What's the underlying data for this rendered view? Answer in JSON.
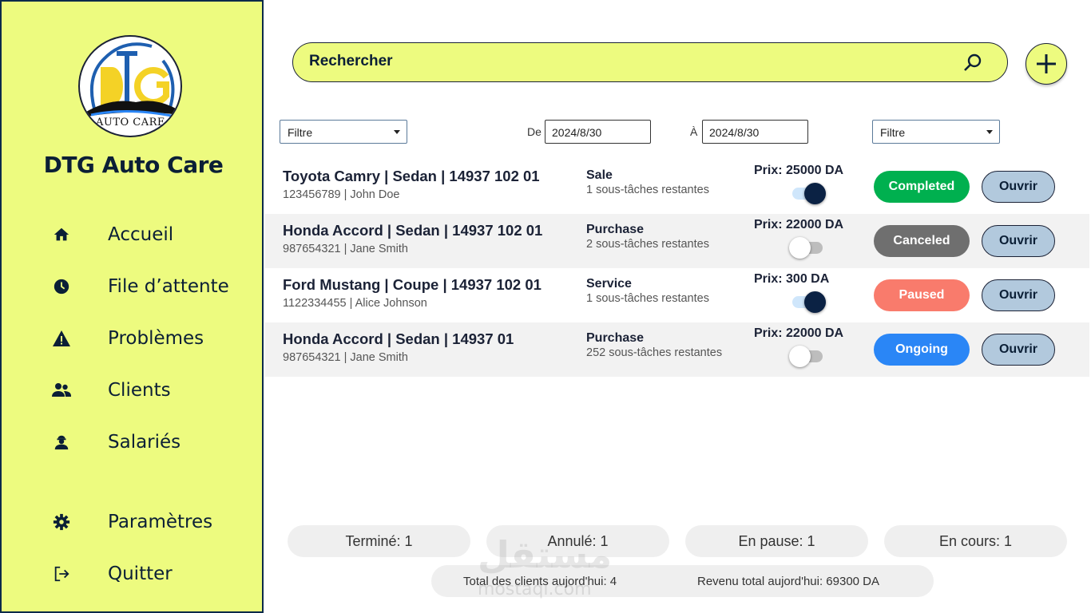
{
  "app": {
    "brand_name": "DTG Auto Care",
    "logo_text": "AUTO CARE",
    "logo_letters": "DTG"
  },
  "sidebar": {
    "items": [
      {
        "label": "Accueil",
        "icon": "home-icon"
      },
      {
        "label": "File d’attente",
        "icon": "clock-icon"
      },
      {
        "label": "Problèmes",
        "icon": "warning-icon"
      },
      {
        "label": "Clients",
        "icon": "people-icon"
      },
      {
        "label": "Salariés",
        "icon": "worker-icon"
      },
      {
        "label": "Paramètres",
        "icon": "gear-icon"
      },
      {
        "label": "Quitter",
        "icon": "logout-icon"
      }
    ]
  },
  "search": {
    "placeholder": "Rechercher",
    "icon": "search-icon"
  },
  "add_button": {
    "icon": "plus-icon"
  },
  "filters": {
    "left_select": "Filtre",
    "right_select": "Filtre",
    "from_label": "De",
    "from_value": "2024/8/30",
    "to_label": "À",
    "to_value": "2024/8/30"
  },
  "orders": [
    {
      "title": "Toyota Camry | Sedan | 14937 102 01",
      "sub": "123456789 | John Doe",
      "type": "Sale",
      "tasks": "1 sous-tâches restantes",
      "price": "Prix: 25000 DA",
      "toggle_on": true,
      "status": "Completed",
      "status_color": "#00b04f",
      "open_label": "Ouvrir"
    },
    {
      "title": "Honda Accord | Sedan | 14937 102 01",
      "sub": "987654321 | Jane Smith",
      "type": "Purchase",
      "tasks": "2 sous-tâches restantes",
      "price": "Prix: 22000 DA",
      "toggle_on": false,
      "status": "Canceled",
      "status_color": "#6f6f6f",
      "open_label": "Ouvrir"
    },
    {
      "title": "Ford Mustang | Coupe | 14937 102 01",
      "sub": "1122334455 | Alice Johnson",
      "type": "Service",
      "tasks": "1 sous-tâches restantes",
      "price": "Prix: 300 DA",
      "toggle_on": true,
      "status": "Paused",
      "status_color": "#f97b6c",
      "open_label": "Ouvrir"
    },
    {
      "title": "Honda Accord | Sedan | 14937  01",
      "sub": "987654321 | Jane Smith",
      "type": "Purchase",
      "tasks": "252 sous-tâches restantes",
      "price": "Prix: 22000 DA",
      "toggle_on": false,
      "status": "Ongoing",
      "status_color": "#2a86f6",
      "open_label": "Ouvrir"
    }
  ],
  "stats": {
    "done": "Terminé: 1",
    "canceled": "Annulé: 1",
    "paused": "En pause: 1",
    "ongoing": "En cours: 1",
    "total_clients": "Total des clients aujord'hui: 4",
    "total_revenue": "Revenu total aujord'hui: 69300 DA"
  },
  "watermark": {
    "arabic": "مستقل",
    "latin": "mostaql.com"
  },
  "colors": {
    "accent": "#edfb7f",
    "navy": "#0b1f36",
    "open_button": "#b2c9dd"
  }
}
